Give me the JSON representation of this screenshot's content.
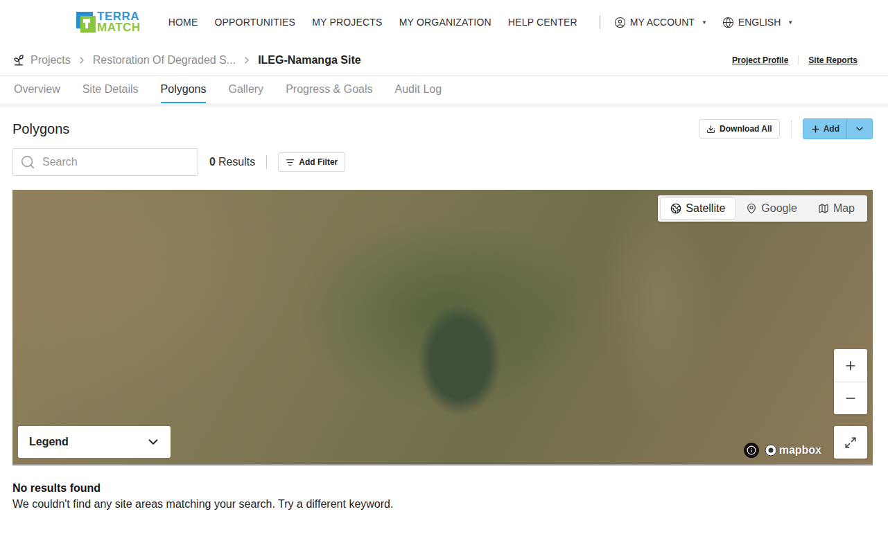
{
  "logo": {
    "line1": "TERRA",
    "line2": "MATCH"
  },
  "nav": {
    "items": [
      "HOME",
      "OPPORTUNITIES",
      "MY PROJECTS",
      "MY ORGANIZATION",
      "HELP CENTER"
    ],
    "account": "MY ACCOUNT",
    "language": "ENGLISH",
    "caret": "▼"
  },
  "breadcrumb": [
    {
      "label": "Projects",
      "current": false
    },
    {
      "label": "Restoration Of Degraded S...",
      "current": false
    },
    {
      "label": "ILEG-Namanga Site",
      "current": true
    }
  ],
  "header_links": [
    "Project Profile",
    "Site Reports"
  ],
  "tabs": [
    {
      "label": "Overview",
      "selected": false
    },
    {
      "label": "Site Details",
      "selected": false
    },
    {
      "label": "Polygons",
      "selected": true
    },
    {
      "label": "Gallery",
      "selected": false
    },
    {
      "label": "Progress & Goals",
      "selected": false
    },
    {
      "label": "Audit Log",
      "selected": false
    }
  ],
  "section": {
    "title": "Polygons",
    "download": "Download All",
    "add": "Add"
  },
  "search": {
    "placeholder": "Search",
    "count": "0",
    "count_label": "Results",
    "filter": "Add Filter"
  },
  "map": {
    "layers": [
      {
        "label": "Satellite",
        "selected": true
      },
      {
        "label": "Google",
        "selected": false
      },
      {
        "label": "Map",
        "selected": false
      }
    ],
    "legend": {
      "label": "Legend",
      "expanded": false
    },
    "attribution": "mapbox"
  },
  "empty": {
    "title": "No results found",
    "message": "We couldn't find any site areas matching your search. Try a different keyword."
  }
}
